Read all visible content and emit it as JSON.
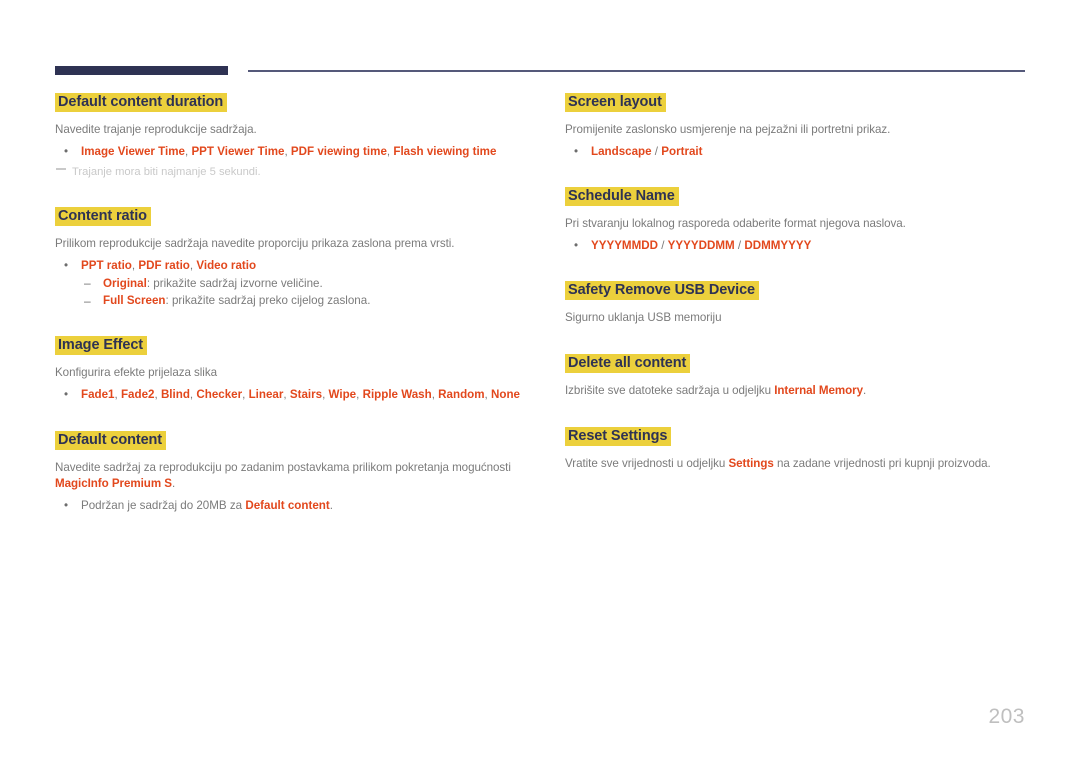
{
  "document": {
    "page_number": "203",
    "accent_colors": {
      "heading_highlight": "#ecd03c",
      "heading_text": "#2e3253",
      "emphasis_text": "#e2481d",
      "body_text": "#7b7b7b",
      "rule_dark": "#2e3253",
      "rule_thin": "#55597a",
      "note_text": "#c9c9c9",
      "page_number_text": "#bfbfbf"
    }
  },
  "left_column": {
    "sections": [
      {
        "heading": "Default content duration",
        "body": "Navedite trajanje reprodukcije sadržaja.",
        "bullet": {
          "items": [
            "Image Viewer Time",
            "PPT Viewer Time",
            "PDF viewing time",
            "Flash viewing time"
          ]
        },
        "note": "Trajanje mora biti najmanje 5 sekundi."
      },
      {
        "heading": "Content ratio",
        "body": "Prilikom reprodukcije sadržaja navedite proporciju prikaza zaslona prema vrsti.",
        "bullet": {
          "items": [
            "PPT ratio",
            "PDF ratio",
            "Video ratio"
          ]
        },
        "subs": [
          {
            "term": "Original",
            "rest": ": prikažite sadržaj izvorne veličine."
          },
          {
            "term": "Full Screen",
            "rest": ": prikažite sadržaj preko cijelog zaslona."
          }
        ]
      },
      {
        "heading": "Image Effect",
        "body": "Konfigurira efekte prijelaza slika",
        "bullet": {
          "items": [
            "Fade1",
            "Fade2",
            "Blind",
            "Checker",
            "Linear",
            "Stairs",
            "Wipe",
            "Ripple Wash",
            "Random",
            "None"
          ]
        }
      },
      {
        "heading": "Default content",
        "body_pre": "Navedite sadržaj za reprodukciju po zadanim postavkama prilikom pokretanja mogućnosti ",
        "body_em": "MagicInfo Premium S",
        "body_post": ".",
        "bullet_pre": "Podržan je sadržaj do 20MB za ",
        "bullet_em": "Default content",
        "bullet_post": "."
      }
    ]
  },
  "right_column": {
    "sections": [
      {
        "heading": "Screen layout",
        "body": "Promijenite zaslonsko usmjerenje na pejzažni ili portretni prikaz.",
        "bullet": {
          "items": [
            "Landscape",
            "Portrait"
          ],
          "separator": " / "
        }
      },
      {
        "heading": "Schedule Name",
        "body": "Pri stvaranju lokalnog rasporeda odaberite format njegova naslova.",
        "bullet": {
          "items": [
            "YYYYMMDD",
            "YYYYDDMM",
            "DDMMYYYY"
          ],
          "separator": " / "
        }
      },
      {
        "heading": "Safety Remove USB Device",
        "body": "Sigurno uklanja USB memoriju"
      },
      {
        "heading": "Delete all content",
        "body_pre": "Izbrišite sve datoteke sadržaja u odjeljku ",
        "body_em": "Internal Memory",
        "body_post": "."
      },
      {
        "heading": "Reset Settings",
        "body_pre": "Vratite sve vrijednosti u odjeljku ",
        "body_em": "Settings",
        "body_post": " na zadane vrijednosti pri kupnji proizvoda."
      }
    ]
  }
}
